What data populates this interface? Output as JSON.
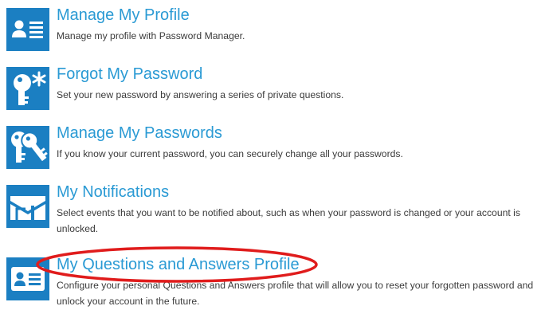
{
  "menu": {
    "items": [
      {
        "title": "Manage My Profile",
        "description": "Manage my profile with Password Manager.",
        "icon": "id-card-icon"
      },
      {
        "title": "Forgot My Password",
        "description": "Set your new password by answering a series of private questions.",
        "icon": "key-asterisk-icon"
      },
      {
        "title": "Manage My Passwords",
        "description": "If you know your current password, you can securely change all your passwords.",
        "icon": "keys-icon"
      },
      {
        "title": "My Notifications",
        "description": "Select events that you want to be notified about, such as when your password is changed or your account is unlocked.",
        "icon": "mail-notification-icon"
      },
      {
        "title": "My Questions and Answers Profile",
        "description": "Configure your personal Questions and Answers profile that will allow you to reset your forgotten password and unlock your account in the future.",
        "icon": "profile-card-icon"
      }
    ]
  },
  "colors": {
    "tile": "#1b7fc2",
    "title": "#2a9ad4",
    "description": "#3b3b3b",
    "annotation": "#e01c1c"
  }
}
